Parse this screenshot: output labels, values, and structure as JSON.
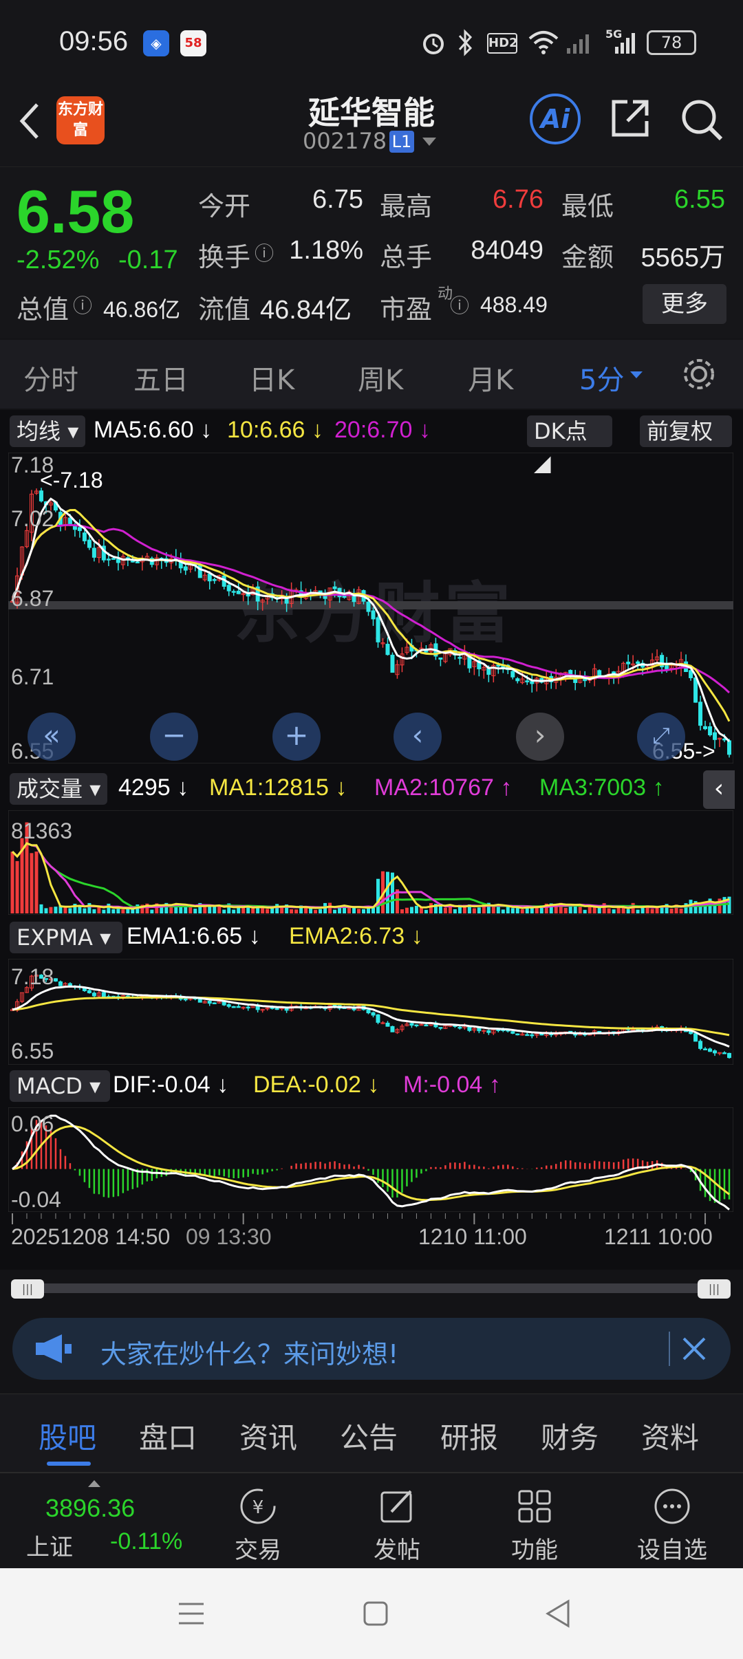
{
  "status_bar": {
    "time": "09:56",
    "battery": "78",
    "network": "5G",
    "hd": "HD2"
  },
  "header": {
    "title": "延华智能",
    "code": "002178",
    "level_badge": "L1",
    "logo_text": "东方财富",
    "ai_label": "Ai"
  },
  "quote": {
    "price": "6.58",
    "change_pct": "-2.52%",
    "change_abs": "-0.17",
    "open_label": "今开",
    "open": "6.75",
    "high_label": "最高",
    "high": "6.76",
    "low_label": "最低",
    "low": "6.55",
    "turnover_label": "换手",
    "turnover": "1.18%",
    "volume_label": "总手",
    "volume": "84049",
    "amount_label": "金额",
    "amount": "5565万",
    "market_cap_label": "总值",
    "market_cap": "46.86亿",
    "float_cap_label": "流值",
    "float_cap": "46.84亿",
    "pe_label": "市盈",
    "pe_sup": "动",
    "pe": "488.49",
    "more_label": "更多"
  },
  "period_tabs": [
    "分时",
    "五日",
    "日K",
    "周K",
    "月K",
    "5分"
  ],
  "active_period": "5分",
  "chart": {
    "ma_selector": "均线",
    "ma5": "MA5:6.60",
    "ma10": "10:6.66",
    "ma20": "20:6.70",
    "dk_label": "DK点",
    "adjust_label": "前复权",
    "price_axis": [
      "7.18",
      "7.02",
      "6.87",
      "6.71",
      "6.55"
    ],
    "max_marker": "<-7.18",
    "min_marker": "6.55->",
    "watermark": "东方财富",
    "vol_selector": "成交量",
    "vol_value": "4295",
    "vol_ma1": "MA1:12815",
    "vol_ma2": "MA2:10767",
    "vol_ma3": "MA3:7003",
    "vol_axis_max": "81363",
    "expma_selector": "EXPMA",
    "ema1": "EMA1:6.65",
    "ema2": "EMA2:6.73",
    "expma_axis": [
      "7.18",
      "6.55"
    ],
    "macd_selector": "MACD",
    "dif": "DIF:-0.04",
    "dea": "DEA:-0.02",
    "m": "M:-0.04",
    "macd_axis": [
      "0.06",
      "-0.04"
    ],
    "time_axis": [
      "20251208 14:50",
      "09 13:30",
      "1210 11:00",
      "1211 10:00"
    ]
  },
  "chart_data": {
    "type": "candlestick",
    "ylim": [
      6.55,
      7.18
    ],
    "max_marker": 7.18,
    "min_marker": 6.55,
    "time_labels": [
      "20251208 14:50",
      "09 13:30",
      "1210 11:00",
      "1211 10:00"
    ],
    "latest": {
      "ma5": 6.6,
      "ma10": 6.66,
      "ma20": 6.7,
      "volume": 4295,
      "vol_ma1": 12815,
      "vol_ma2": 10767,
      "vol_ma3": 7003,
      "ema1": 6.65,
      "ema2": 6.73,
      "dif": -0.04,
      "dea": -0.02,
      "m": -0.04
    },
    "vol_max": 81363,
    "macd_range": [
      -0.04,
      0.06
    ],
    "colors": {
      "up": "#f03c3c",
      "down": "#2ee6e6",
      "ma5": "#ffffff",
      "ma10": "#f5e642",
      "ma20": "#d020d0",
      "vol_ma3": "#2bd52b"
    }
  },
  "promo": {
    "text": "大家在炒什么？来问妙想!"
  },
  "bottom_tabs": [
    "股吧",
    "盘口",
    "资讯",
    "公告",
    "研报",
    "财务",
    "资料"
  ],
  "active_bottom_tab": "股吧",
  "toolbar": {
    "index_value": "3896.36",
    "index_name": "上证",
    "index_change": "-0.11%",
    "trade": "交易",
    "post": "发帖",
    "functions": "功能",
    "watchlist": "设自选"
  }
}
